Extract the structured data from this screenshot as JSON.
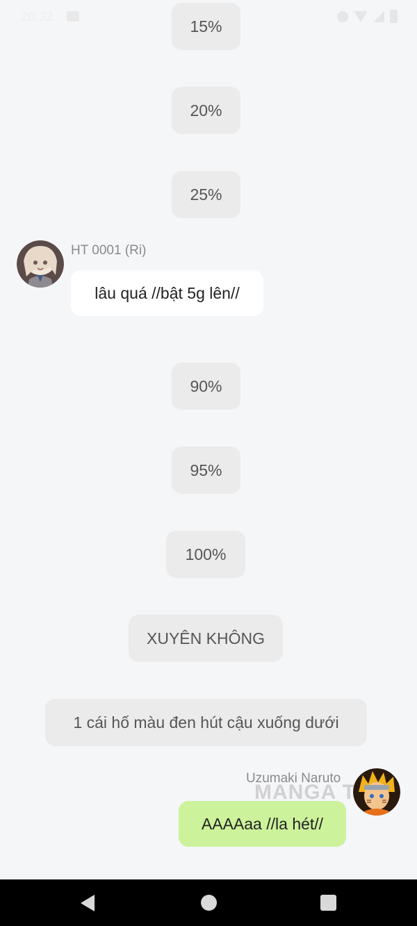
{
  "status_bar": {
    "time": "20:32"
  },
  "messages": {
    "pill_15": "15%",
    "pill_20": "20%",
    "pill_25": "25%",
    "ri": {
      "name": "HT 0001 (Ri)",
      "text": "lâu quá //bật 5g lên//"
    },
    "pill_90": "90%",
    "pill_95": "95%",
    "pill_100": "100%",
    "pill_xuyen": "XUYÊN KHÔNG",
    "pill_hole": "1 cái hố màu đen hút cậu xuống dưới",
    "naruto": {
      "name": "Uzumaki Naruto",
      "text": "AAAAaa //la hét//"
    }
  },
  "watermark": "MANGA TO",
  "colors": {
    "background": "#f5f6f8",
    "pill": "#ebebeb",
    "bubble_self": "#ccf29b",
    "bubble_other": "#ffffff"
  },
  "nav_bar": {
    "icons": [
      "back-icon",
      "home-icon",
      "recents-icon"
    ]
  }
}
